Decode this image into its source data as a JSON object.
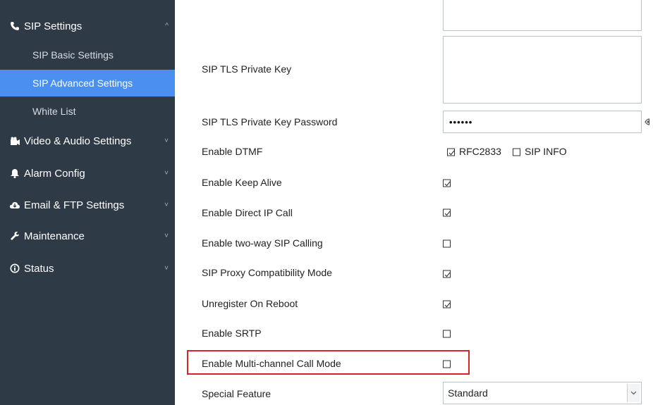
{
  "sidebar": {
    "groups": [
      {
        "label": "SIP Settings",
        "icon": "phone-icon",
        "chevron": "^"
      },
      {
        "label": "Video & Audio Settings",
        "icon": "video-icon",
        "chevron": "˅"
      },
      {
        "label": "Alarm Config",
        "icon": "bell-icon",
        "chevron": "˅"
      },
      {
        "label": "Email & FTP Settings",
        "icon": "cloud-icon",
        "chevron": "˅"
      },
      {
        "label": "Maintenance",
        "icon": "wrench-icon",
        "chevron": "˅"
      },
      {
        "label": "Status",
        "icon": "info-icon",
        "chevron": "˅"
      }
    ],
    "sip_items": [
      {
        "label": "SIP Basic Settings",
        "active": false
      },
      {
        "label": "SIP Advanced Settings",
        "active": true
      },
      {
        "label": "White List",
        "active": false
      }
    ]
  },
  "form": {
    "tls_private_key": {
      "label": "SIP TLS Private Key"
    },
    "tls_key_password": {
      "label": "SIP TLS Private Key Password",
      "value": "••••••"
    },
    "dtmf": {
      "label": "Enable DTMF",
      "options": [
        {
          "label": "RFC2833",
          "checked": true
        },
        {
          "label": "SIP INFO",
          "checked": false
        }
      ]
    },
    "keep_alive": {
      "label": "Enable Keep Alive",
      "checked": true
    },
    "direct_ip_call": {
      "label": "Enable Direct IP Call",
      "checked": true
    },
    "two_way_sip": {
      "label": "Enable two-way SIP Calling",
      "checked": false
    },
    "proxy_compat": {
      "label": "SIP Proxy Compatibility Mode",
      "checked": true
    },
    "unregister_reboot": {
      "label": "Unregister On Reboot",
      "checked": true
    },
    "srtp": {
      "label": "Enable SRTP",
      "checked": false
    },
    "multi_channel": {
      "label": "Enable Multi-channel Call Mode",
      "checked": false
    },
    "special_feature": {
      "label": "Special Feature",
      "value": "Standard"
    }
  },
  "colors": {
    "sidebar_bg": "#2f3a47",
    "active_item": "#4b8ff0",
    "highlight_border": "#d8232a"
  }
}
